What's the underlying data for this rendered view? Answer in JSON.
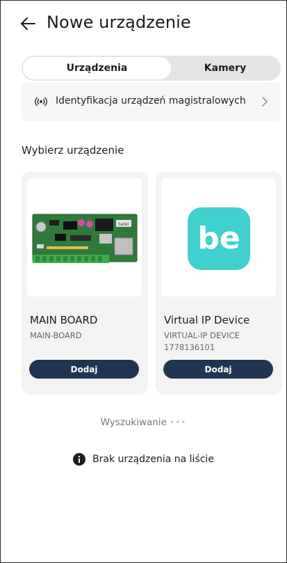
{
  "header": {
    "title": "Nowe urządzenie",
    "back_icon": "arrow-left-icon"
  },
  "tabs": [
    {
      "label": "Urządzenia",
      "selected": true
    },
    {
      "label": "Kamery",
      "selected": false
    }
  ],
  "identification": {
    "label": "Identyfikacja urządzeń magistralowych",
    "icon": "signal-icon",
    "chevron": ">"
  },
  "section": {
    "title": "Wybierz urządzenie"
  },
  "devices": [
    {
      "name": "MAIN BOARD",
      "code": "MAIN-BOARD",
      "serial": "",
      "button": "Dodaj",
      "image": "pcb-board"
    },
    {
      "name": "Virtual IP Device",
      "code": "VIRTUAL-IP DEVICE",
      "serial": "1778136101",
      "button": "Dodaj",
      "image": "be-logo",
      "logo_text": "be"
    }
  ],
  "searching": {
    "label": "Wyszukiwanie",
    "dots": "•••"
  },
  "no_device": {
    "label": "Brak urządzenia na liście",
    "icon": "info-icon"
  },
  "colors": {
    "button": "#1f3551",
    "segment_bg": "#e5e5e5",
    "card_bg": "#f3f3f3",
    "logo_bg": "#3fd0cf"
  }
}
